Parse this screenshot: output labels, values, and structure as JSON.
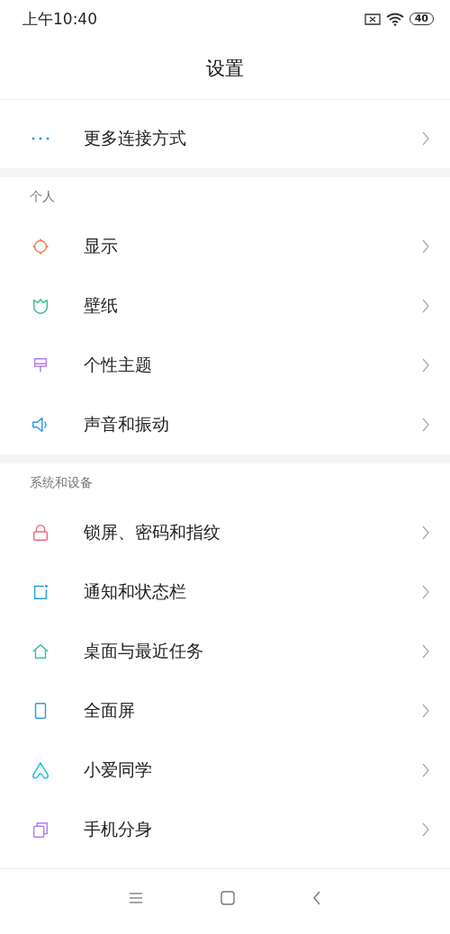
{
  "status_bar": {
    "time": "上午10:40",
    "battery": "40"
  },
  "title": "设置",
  "top_items": [
    {
      "label": "更多连接方式",
      "kind": "dots",
      "color": "#2a9de0"
    }
  ],
  "sections": [
    {
      "header": "个人",
      "items": [
        {
          "label": "显示",
          "kind": "sun",
          "color": "#f0844e"
        },
        {
          "label": "壁纸",
          "kind": "tulip",
          "color": "#2fbf9a"
        },
        {
          "label": "个性主题",
          "kind": "brush",
          "color": "#b47cf0"
        },
        {
          "label": "声音和振动",
          "kind": "speaker",
          "color": "#2a9de0"
        }
      ]
    },
    {
      "header": "系统和设备",
      "items": [
        {
          "label": "锁屏、密码和指纹",
          "kind": "lock",
          "color": "#ec6a80"
        },
        {
          "label": "通知和状态栏",
          "kind": "notify",
          "color": "#2a9de0"
        },
        {
          "label": "桌面与最近任务",
          "kind": "home",
          "color": "#3cc2a0"
        },
        {
          "label": "全面屏",
          "kind": "phone",
          "color": "#2a9de0"
        },
        {
          "label": "小爱同学",
          "kind": "ai",
          "color": "#22c8e8"
        },
        {
          "label": "手机分身",
          "kind": "dual",
          "color": "#b47cf0"
        }
      ]
    }
  ]
}
